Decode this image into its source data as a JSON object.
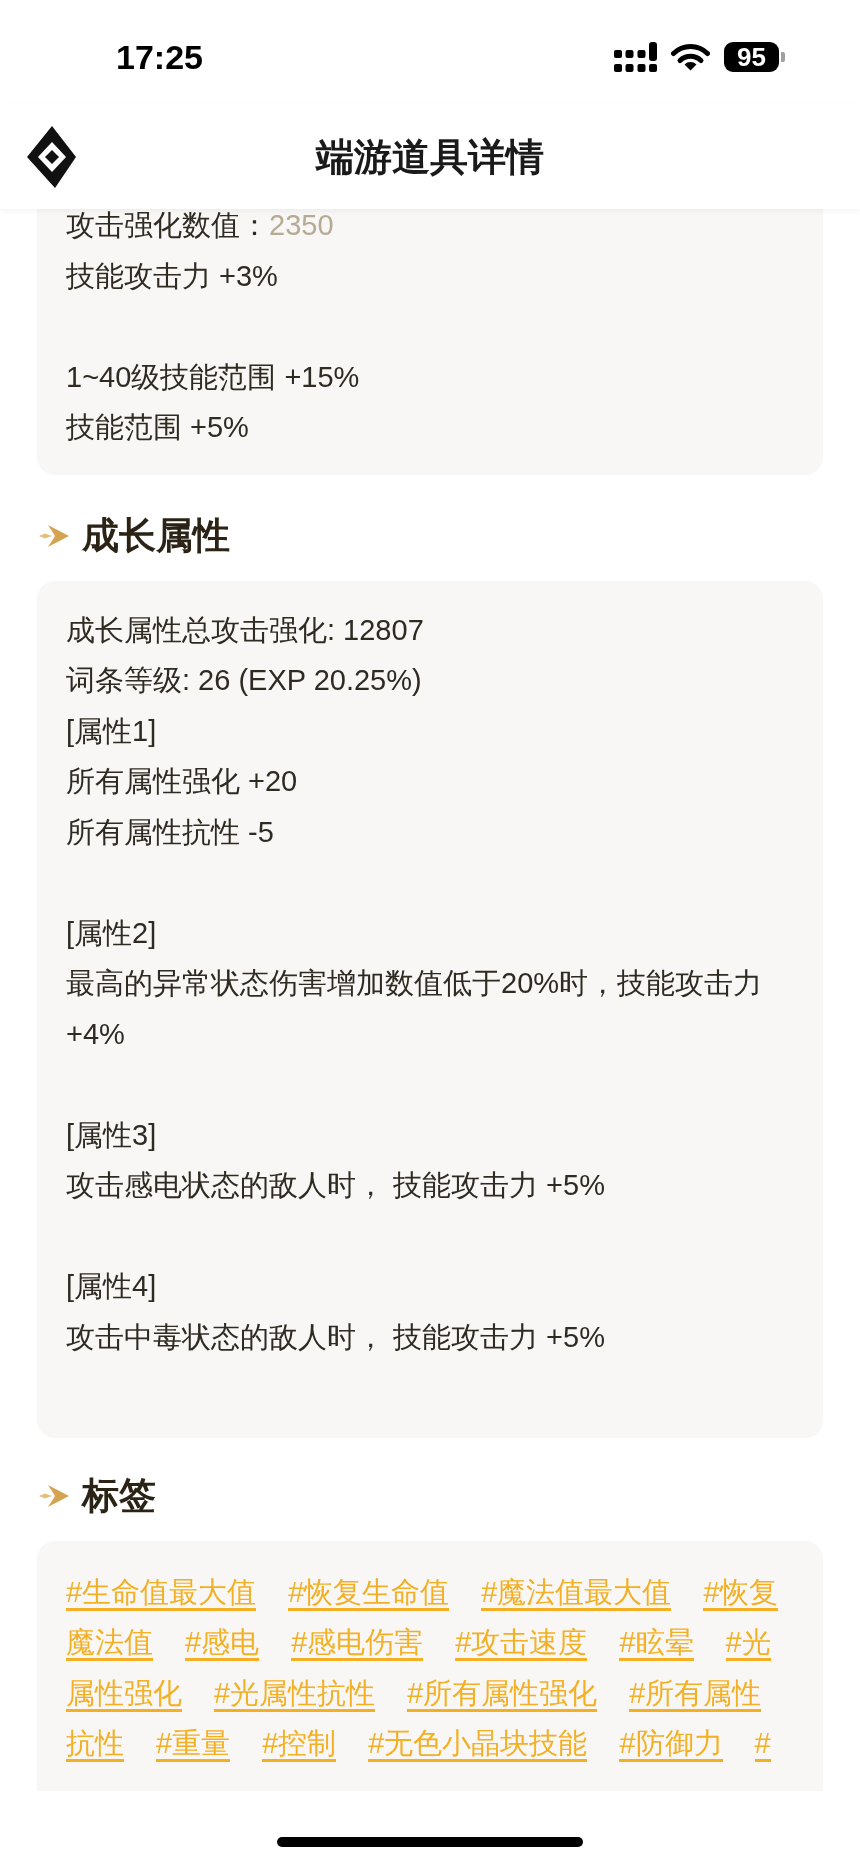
{
  "status_bar": {
    "time": "17:25",
    "battery": "95"
  },
  "nav_bar": {
    "title": "端游道具详情"
  },
  "top_card": {
    "stat": {
      "label": "攻击强化数值：",
      "value": "2350"
    },
    "groups": [
      [
        "技能攻击力 +3%"
      ],
      [
        "1~40级技能范围 +15%",
        "技能范围 +5%"
      ]
    ]
  },
  "sections": [
    {
      "kind": "text",
      "title": "成长属性",
      "groups": [
        [
          "成长属性总攻击强化: 12807",
          "词条等级: 26 (EXP 20.25%)",
          "[属性1]",
          "所有属性强化 +20",
          "所有属性抗性 -5"
        ],
        [
          "[属性2]",
          "最高的异常状态伤害增加数值低于20%时，技能攻击力 +4%"
        ],
        [
          "[属性3]",
          "攻击感电状态的敌人时， 技能攻击力 +5%"
        ],
        [
          "[属性4]",
          "攻击中毒状态的敌人时， 技能攻击力 +5%"
        ]
      ]
    },
    {
      "kind": "tags",
      "title": "标签",
      "tags": [
        {
          "parts": [
            "#生命值最大值"
          ]
        },
        {
          "parts": [
            "#恢复生命值"
          ]
        },
        {
          "parts": [
            "#魔法值最大值"
          ]
        },
        {
          "parts": [
            "#恢复",
            "魔法值"
          ]
        },
        {
          "parts": [
            "#感电"
          ]
        },
        {
          "parts": [
            "#感电伤害"
          ]
        },
        {
          "parts": [
            "#攻击速度"
          ]
        },
        {
          "parts": [
            "#眩晕"
          ]
        },
        {
          "parts": [
            "#光",
            "属性强化"
          ]
        },
        {
          "parts": [
            "#光属性抗性"
          ]
        },
        {
          "parts": [
            "#所有属性强化"
          ]
        },
        {
          "parts": [
            "#所有属性",
            "抗性"
          ]
        },
        {
          "parts": [
            "#重量"
          ]
        },
        {
          "parts": [
            "#控制"
          ]
        },
        {
          "parts": [
            "#无色小晶块技能"
          ]
        },
        {
          "parts": [
            "#防御力"
          ]
        },
        {
          "parts": [
            "#"
          ]
        }
      ]
    }
  ]
}
